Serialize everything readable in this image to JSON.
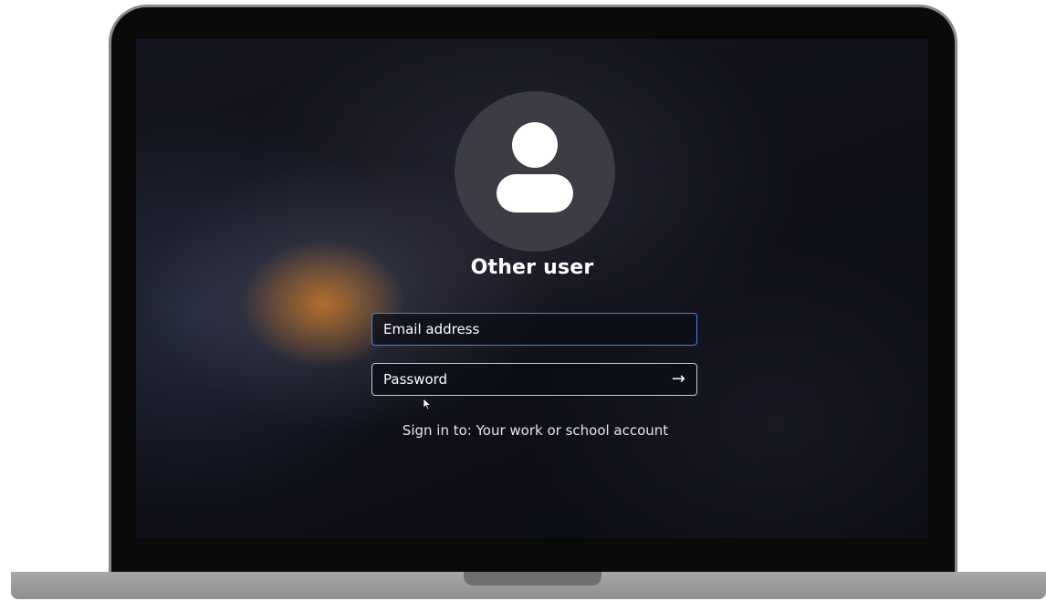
{
  "login": {
    "title": "Other user",
    "email_placeholder": "Email address",
    "password_placeholder": "Password",
    "submit_arrow": "→",
    "sign_in_hint": "Sign in to: Your work or school account"
  },
  "icons": {
    "avatar": "user-avatar-icon",
    "submit": "arrow-right-icon",
    "cursor": "mouse-pointer-icon"
  },
  "colors": {
    "focus_border": "#4a86e0",
    "avatar_bg": "#3b3c44"
  }
}
